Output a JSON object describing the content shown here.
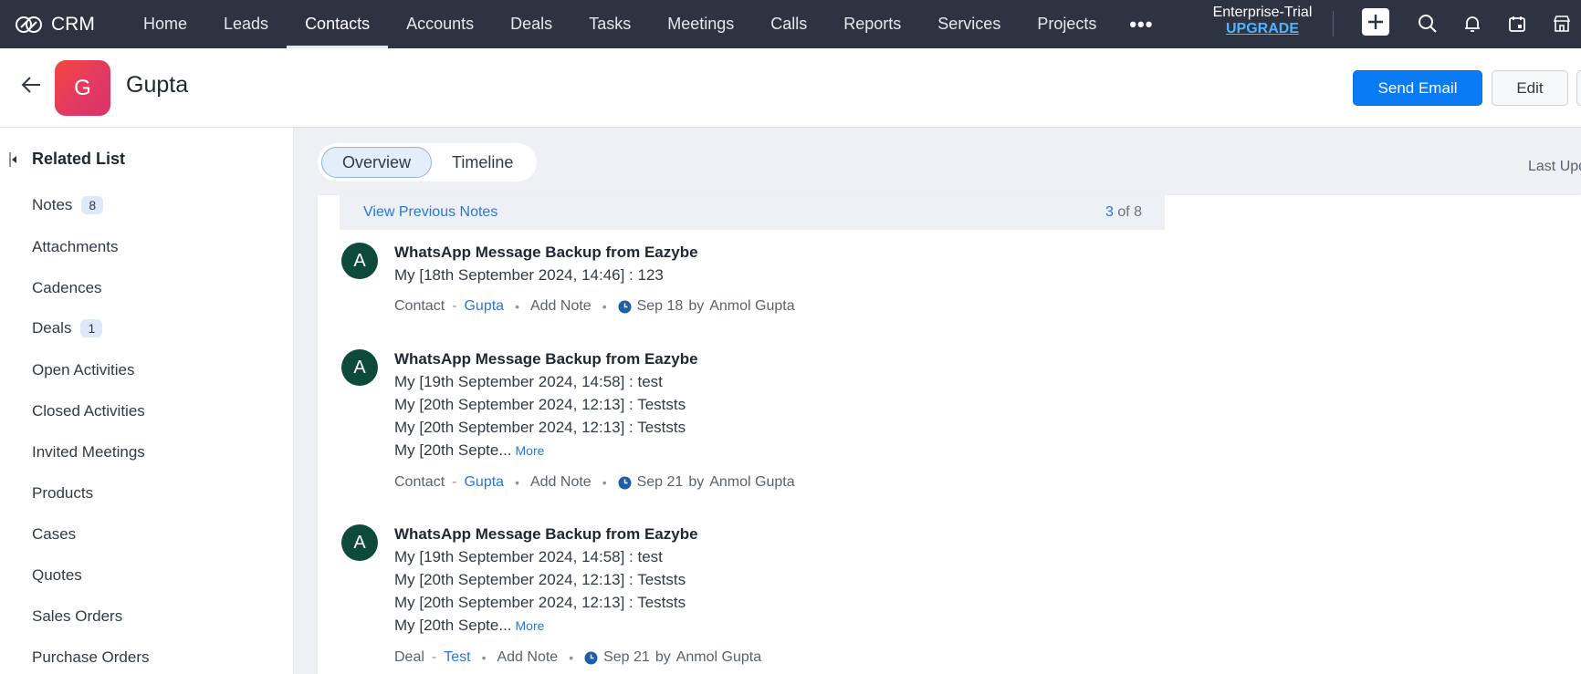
{
  "topbar": {
    "brand": "CRM",
    "nav": [
      "Home",
      "Leads",
      "Contacts",
      "Accounts",
      "Deals",
      "Tasks",
      "Meetings",
      "Calls",
      "Reports",
      "Services",
      "Projects"
    ],
    "active_tab": "Contacts",
    "more_label": "•••",
    "trial_label": "Enterprise-Trial",
    "upgrade_label": "UPGRADE",
    "icons": [
      "plus-icon",
      "search-icon",
      "bell-icon",
      "calendar-icon",
      "store-icon"
    ]
  },
  "header": {
    "avatar_letter": "G",
    "record_name": "Gupta",
    "send_email_label": "Send Email",
    "edit_label": "Edit"
  },
  "sidebar": {
    "title": "Related List",
    "items": [
      {
        "label": "Notes",
        "badge": "8"
      },
      {
        "label": "Attachments",
        "badge": ""
      },
      {
        "label": "Cadences",
        "badge": ""
      },
      {
        "label": "Deals",
        "badge": "1"
      },
      {
        "label": "Open Activities",
        "badge": ""
      },
      {
        "label": "Closed Activities",
        "badge": ""
      },
      {
        "label": "Invited Meetings",
        "badge": ""
      },
      {
        "label": "Products",
        "badge": ""
      },
      {
        "label": "Cases",
        "badge": ""
      },
      {
        "label": "Quotes",
        "badge": ""
      },
      {
        "label": "Sales Orders",
        "badge": ""
      },
      {
        "label": "Purchase Orders",
        "badge": ""
      }
    ]
  },
  "main": {
    "tabs": [
      "Overview",
      "Timeline"
    ],
    "active_tab": "Overview",
    "last_updated_label": "Last Upd",
    "notes": {
      "view_previous_label": "View Previous Notes",
      "count_current": "3",
      "count_suffix": "of 8",
      "items": [
        {
          "avatar": "A",
          "title": "WhatsApp Message Backup from Eazybe",
          "lines": [
            "My [18th September 2024, 14:46] : 123"
          ],
          "more": "",
          "entity_type": "Contact",
          "entity_name": "Gupta",
          "add_note": "Add Note",
          "date": "Sep 18",
          "by_label": "by",
          "author": "Anmol Gupta"
        },
        {
          "avatar": "A",
          "title": "WhatsApp Message Backup from Eazybe",
          "lines": [
            "My [19th September 2024, 14:58] : test",
            "My [20th September 2024, 12:13] : Teststs",
            "My [20th September 2024, 12:13] : Teststs",
            "My [20th Septe..."
          ],
          "more": "More",
          "entity_type": "Contact",
          "entity_name": "Gupta",
          "add_note": "Add Note",
          "date": "Sep 21",
          "by_label": "by",
          "author": "Anmol Gupta"
        },
        {
          "avatar": "A",
          "title": "WhatsApp Message Backup from Eazybe",
          "lines": [
            "My [19th September 2024, 14:58] : test",
            "My [20th September 2024, 12:13] : Teststs",
            "My [20th September 2024, 12:13] : Teststs",
            "My [20th Septe..."
          ],
          "more": "More",
          "entity_type": "Deal",
          "entity_name": "Test",
          "add_note": "Add Note",
          "date": "Sep 21",
          "by_label": "by",
          "author": "Anmol Gupta"
        }
      ]
    }
  },
  "colors": {
    "topbar_bg": "#2d3340",
    "accent_blue": "#0a7bf3",
    "link_blue": "#2a77d6",
    "upgrade_blue": "#4fb4ff",
    "note_avatar": "#0d4a3c",
    "avatar_gradient": "#f4473f"
  }
}
